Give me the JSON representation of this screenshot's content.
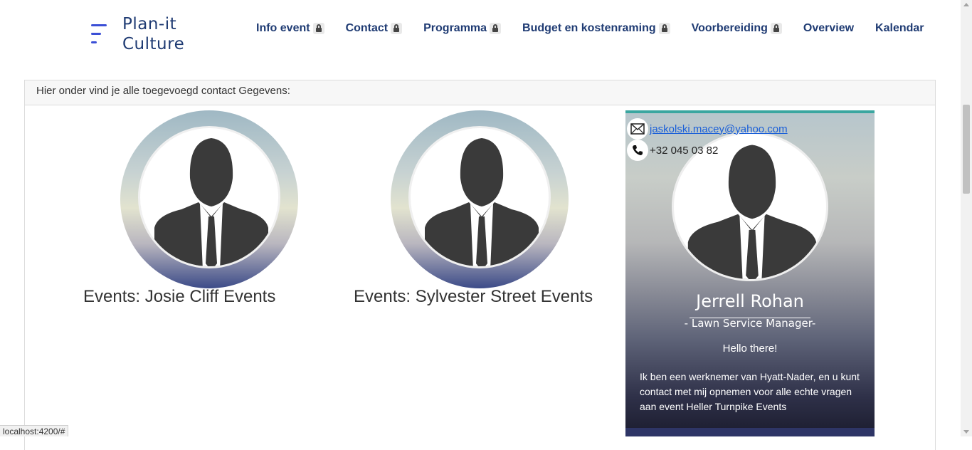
{
  "brand": {
    "line1": "Plan-it",
    "line2": "Culture"
  },
  "nav": [
    {
      "label": "Info event",
      "locked": true
    },
    {
      "label": "Contact",
      "locked": true
    },
    {
      "label": "Programma",
      "locked": true
    },
    {
      "label": "Budget en kostenraming",
      "locked": true
    },
    {
      "label": "Voorbereiding",
      "locked": true
    },
    {
      "label": "Overview",
      "locked": false
    },
    {
      "label": "Kalendar",
      "locked": false
    }
  ],
  "panel": {
    "header": "Hier onder vind je alle toegevoegd contact Gegevens:"
  },
  "contacts": [
    {
      "event_label": "Events: Josie Cliff Events"
    },
    {
      "event_label": "Events: Sylvester Street Events"
    }
  ],
  "card": {
    "email": "jaskolski.macey@yahoo.com",
    "phone": "+32 045 03 82",
    "name": "Jerrell Rohan",
    "role": "- Lawn Service Manager-",
    "greeting": "Hello there!",
    "description": "Ik ben een werknemer van Hyatt-Nader, en u kunt contact met mij opnemen voor alle echte vragen aan event Heller Turnpike Events"
  },
  "status_bar": {
    "url": "localhost:4200/#"
  },
  "colors": {
    "brand": "#1f3b73",
    "accent": "#3b4fd6",
    "card_top": "#3aa6a0",
    "link": "#1a5fd8"
  }
}
